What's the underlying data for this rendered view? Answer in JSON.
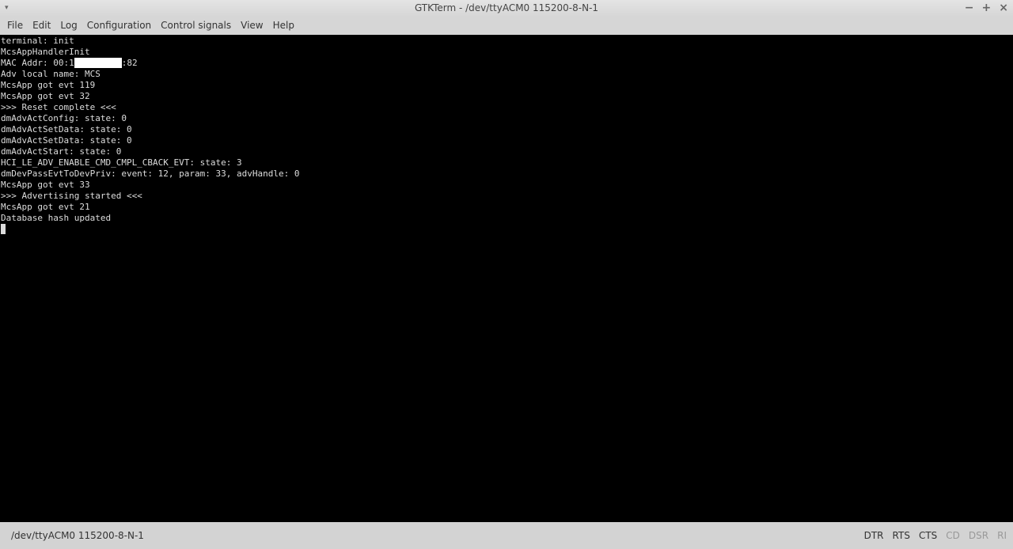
{
  "window": {
    "title": "GTKTerm - /dev/ttyACM0  115200-8-N-1",
    "menu_icon": "▾",
    "minimize": "−",
    "maximize": "+",
    "close": "×"
  },
  "menu": [
    "File",
    "Edit",
    "Log",
    "Configuration",
    "Control signals",
    "View",
    "Help"
  ],
  "terminal": {
    "lines": [
      "terminal: init",
      "McsAppHandlerInit"
    ],
    "mac_prefix": "MAC Addr: 00:1",
    "mac_suffix": ":82",
    "lines2": [
      "Adv local name: MCS",
      "McsApp got evt 119",
      "McsApp got evt 32",
      ">>> Reset complete <<<",
      "dmAdvActConfig: state: 0",
      "dmAdvActSetData: state: 0",
      "dmAdvActSetData: state: 0",
      "dmAdvActStart: state: 0",
      "HCI_LE_ADV_ENABLE_CMD_CMPL_CBACK_EVT: state: 3",
      "dmDevPassEvtToDevPriv: event: 12, param: 33, advHandle: 0",
      "McsApp got evt 33",
      ">>> Advertising started <<<",
      "McsApp got evt 21",
      "Database hash updated"
    ]
  },
  "status": {
    "port": "/dev/ttyACM0  115200-8-N-1",
    "signals": [
      {
        "label": "DTR",
        "active": true
      },
      {
        "label": "RTS",
        "active": true
      },
      {
        "label": "CTS",
        "active": true
      },
      {
        "label": "CD",
        "active": false
      },
      {
        "label": "DSR",
        "active": false
      },
      {
        "label": "RI",
        "active": false
      }
    ]
  }
}
